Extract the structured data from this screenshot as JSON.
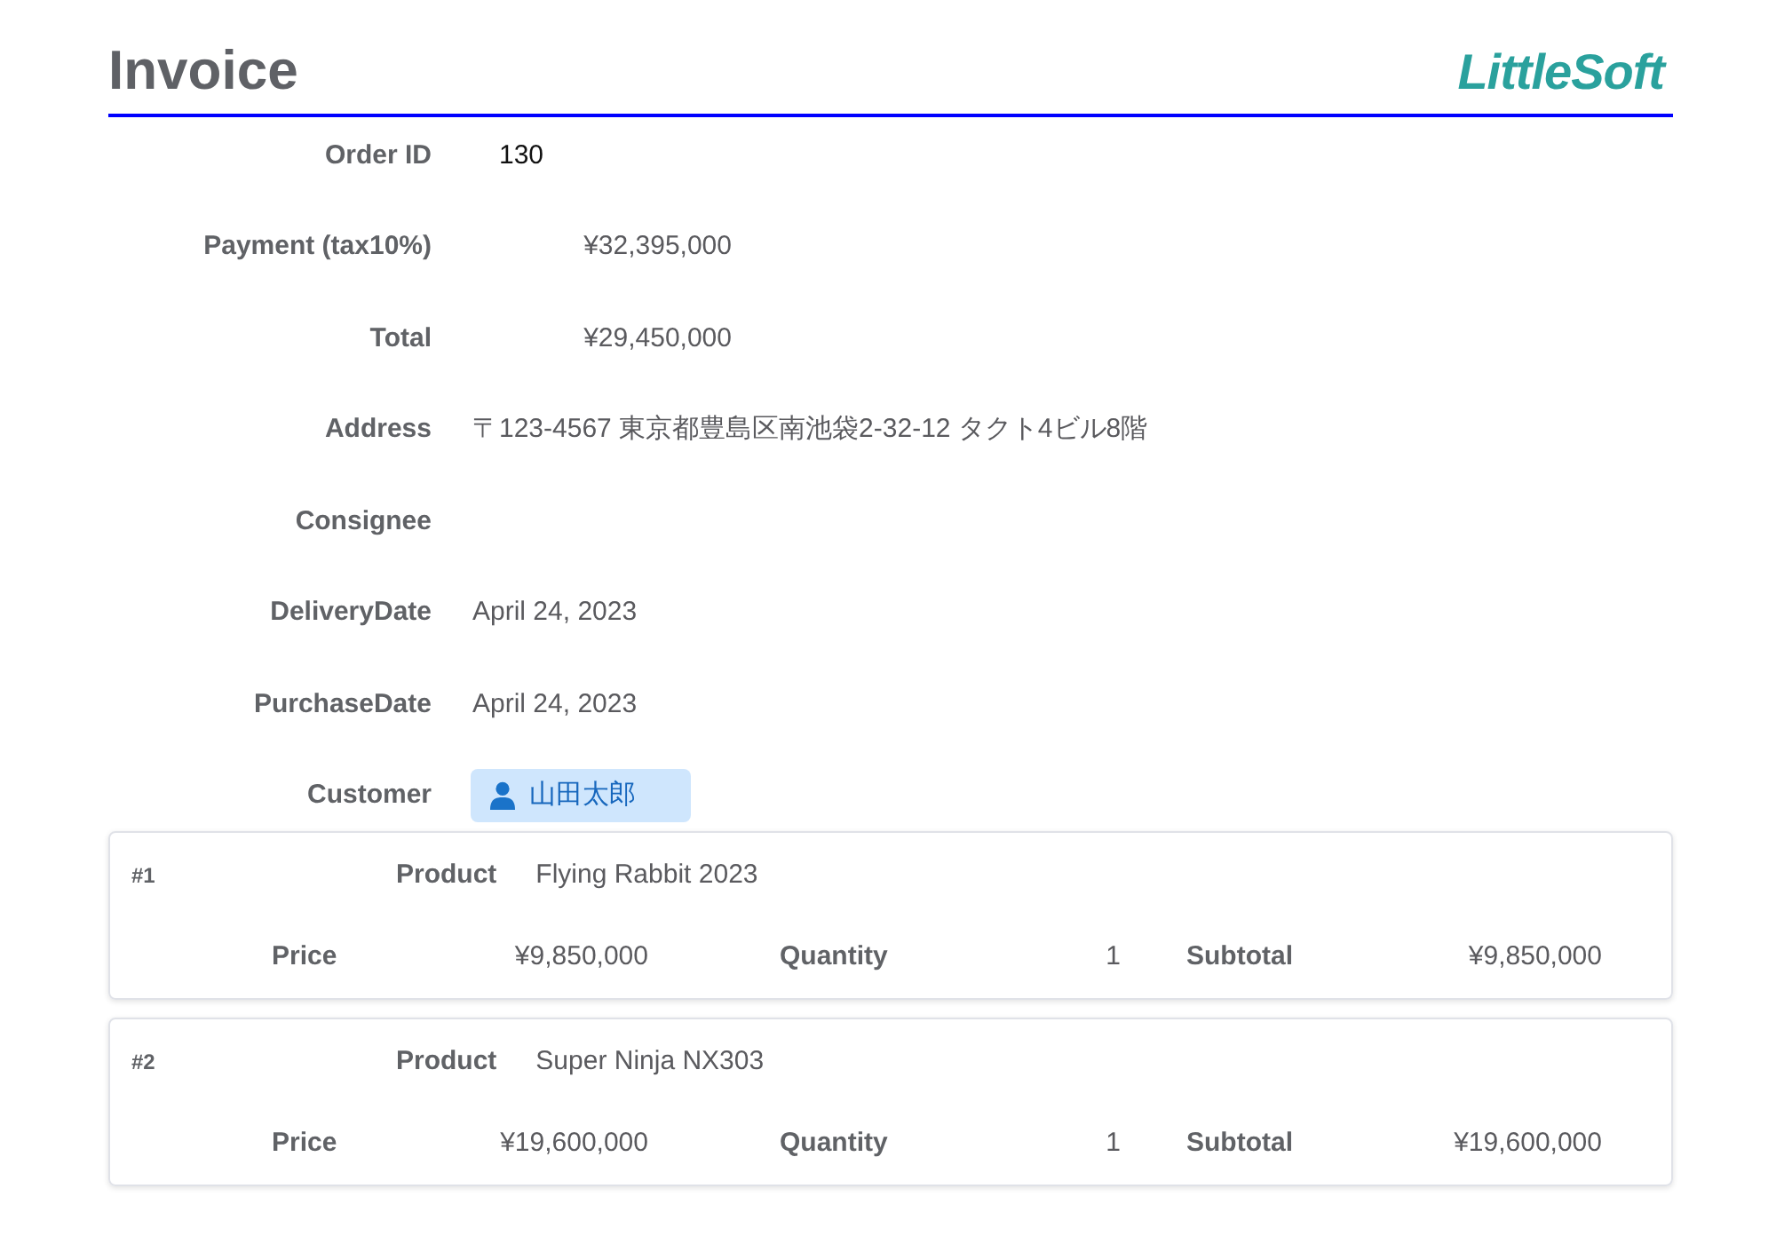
{
  "title": "Invoice",
  "logo": "LittleSoft",
  "fields": [
    {
      "label": "Order ID",
      "value": "130",
      "kind": "id"
    },
    {
      "label": "Payment (tax10%)",
      "value": "¥32,395,000",
      "kind": "money"
    },
    {
      "label": "Total",
      "value": "¥29,450,000",
      "kind": "money"
    },
    {
      "label": "Address",
      "value": "〒123-4567 東京都豊島区南池袋2-32-12 タクト4ビル8階",
      "kind": "text"
    },
    {
      "label": "Consignee"
    },
    {
      "label": "DeliveryDate",
      "value": "April 24, 2023",
      "kind": "text"
    },
    {
      "label": "PurchaseDate",
      "value": "April 24, 2023",
      "kind": "text"
    },
    {
      "label": "Customer",
      "value": "山田太郎",
      "kind": "person"
    }
  ],
  "items": [
    {
      "number": "#1",
      "product_label": "Product",
      "product": "Flying Rabbit 2023",
      "price_label": "Price",
      "price": "¥9,850,000",
      "quantity_label": "Quantity",
      "quantity": "1",
      "subtotal_label": "Subtotal",
      "subtotal": "¥9,850,000"
    },
    {
      "number": "#2",
      "product_label": "Product",
      "product": "Super Ninja NX303",
      "price_label": "Price",
      "price": "¥19,600,000",
      "quantity_label": "Quantity",
      "quantity": "1",
      "subtotal_label": "Subtotal",
      "subtotal": "¥19,600,000"
    }
  ]
}
